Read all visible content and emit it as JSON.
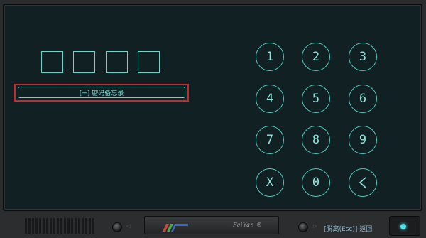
{
  "pin": {
    "box_count": 4
  },
  "memo": {
    "label": "[=] 密码备忘录"
  },
  "keypad": {
    "keys": [
      {
        "label": "1"
      },
      {
        "label": "2"
      },
      {
        "label": "3"
      },
      {
        "label": "4"
      },
      {
        "label": "5"
      },
      {
        "label": "6"
      },
      {
        "label": "7"
      },
      {
        "label": "8"
      },
      {
        "label": "9"
      },
      {
        "label": "X"
      },
      {
        "label": "0"
      },
      {
        "label": "<",
        "icon": "back-arrow-icon"
      }
    ]
  },
  "footer": {
    "brand": "FeiYan ®",
    "back_hint": "[脱离(Esc)] 返回"
  },
  "colors": {
    "accent": "#6fd3c9",
    "highlight_border": "#c62a2a",
    "screen_bg": "#112022",
    "power_led": "#4ee0e8"
  }
}
